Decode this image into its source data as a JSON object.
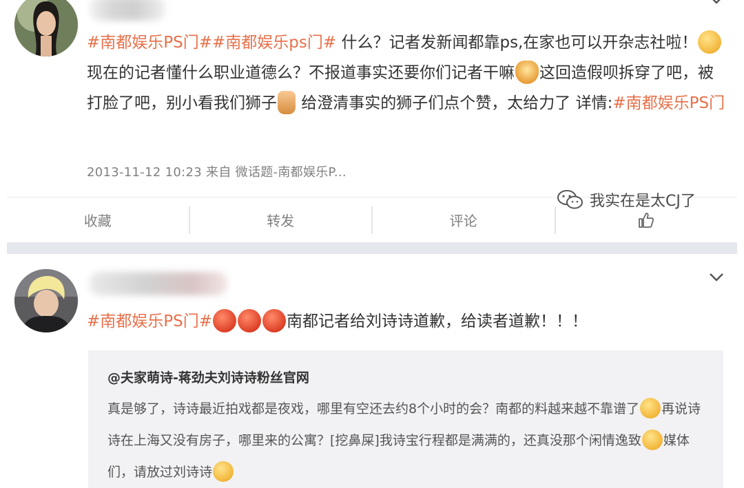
{
  "post1": {
    "avatar_icon": "user-avatar-woman",
    "hashtag1": "#南都娱乐PS门#",
    "hashtag2": "#南都娱乐ps门#",
    "text1": " 什么？记者发新闻都靠ps,在家也可以开杂志社啦！",
    "text2": "现在的记者懂什么职业道德么？不报道事实还要你们记者干嘛",
    "text3": "这回造假呗拆穿了吧，被打脸了吧，别小看我们狮子",
    "text4": " 给澄清事实的狮子们点个赞，太给力了 详情:",
    "hashtag3": "#南都娱乐PS门",
    "meta": "2013-11-12 10:23 来自 微话题-南都娱乐P...",
    "actions": {
      "favorite": "收藏",
      "repost": "转发",
      "comment": "评论",
      "like_icon": "thumbs-up-icon"
    }
  },
  "post2": {
    "avatar_icon": "user-avatar-blond",
    "hashtag": "#南都娱乐PS门#",
    "text": "南都记者给刘诗诗道歉，给读者道歉！！！",
    "quote": {
      "author": "@夫家萌诗-蒋劲夫刘诗诗粉丝官网",
      "text1": "真是够了，诗诗最近拍戏都是夜戏，哪里有空还去约8个小时的会？南都的料越来越不靠谱了",
      "text2": "再说诗诗在上海又没有房子，哪里来的公寓？[挖鼻屎]我诗宝行程都是满满的，还真没那个闲情逸致",
      "text3": "媒体们，请放过刘诗诗"
    }
  },
  "watermark": {
    "icon": "wechat-icon",
    "text": "我实在是太CJ了"
  },
  "colors": {
    "hashtag": "#e8704a",
    "text": "#333333",
    "meta": "#808080",
    "divider": "#e4e7ec",
    "quote_bg": "#f2f2f5"
  }
}
